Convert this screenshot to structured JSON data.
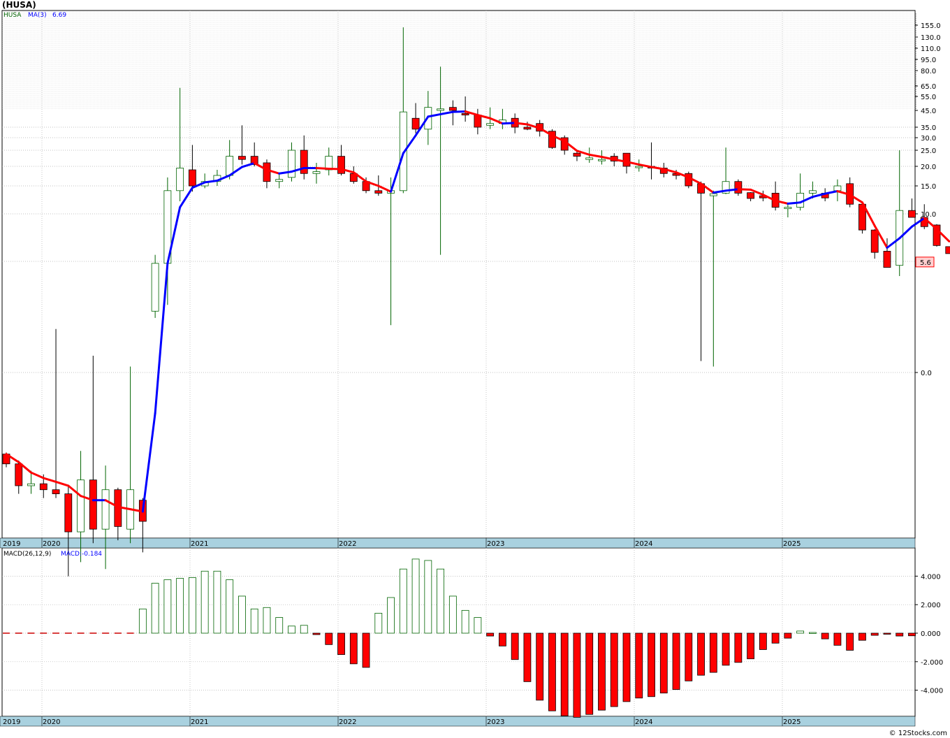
{
  "title": "(HUSA)",
  "watermark": "© 12Stocks.com",
  "colors": {
    "up": "#006400",
    "down": "#ff0000",
    "ma_up": "#0000ff",
    "ma_down": "#ff0000",
    "year_band": "#a9d1df",
    "grid": "#b0b0b0"
  },
  "chart_data": [
    {
      "type": "candlestick",
      "legend": {
        "ticker": "HUSA",
        "ma_label": "MA(3)",
        "ma_value": "6.69"
      },
      "y_scale": "log",
      "y_ticks": [
        "155.0",
        "130.0",
        "110.0",
        "95.0",
        "80.0",
        "65.0",
        "55.0",
        "45.0",
        "35.0",
        "30.0",
        "25.0",
        "20.0",
        "15.0",
        "10.0",
        "5.0",
        "0.0"
      ],
      "last_price_label": "5.6",
      "years": [
        "2019",
        "2020",
        "2021",
        "2022",
        "2023",
        "2024",
        "2025"
      ],
      "ohlc": [
        [
          0.9,
          0.91,
          0.82,
          0.84
        ],
        [
          0.84,
          0.86,
          0.68,
          0.72
        ],
        [
          0.72,
          0.8,
          0.68,
          0.73
        ],
        [
          0.73,
          0.78,
          0.66,
          0.7
        ],
        [
          0.7,
          2.5,
          0.66,
          0.68
        ],
        [
          0.68,
          0.72,
          0.38,
          0.52
        ],
        [
          0.52,
          0.92,
          0.42,
          0.75
        ],
        [
          0.75,
          1.9,
          0.48,
          0.53
        ],
        [
          0.53,
          0.83,
          0.4,
          0.7
        ],
        [
          0.7,
          0.71,
          0.49,
          0.54
        ],
        [
          0.53,
          1.7,
          0.48,
          0.7
        ],
        [
          0.65,
          0.66,
          0.45,
          0.56
        ],
        [
          3.0,
          5.5,
          2.8,
          4.9
        ],
        [
          4.9,
          17.0,
          3.2,
          14.0
        ],
        [
          14.0,
          63.0,
          12.0,
          19.5
        ],
        [
          19.0,
          27.0,
          13.8,
          15.0
        ],
        [
          15.0,
          18.0,
          14.5,
          16.0
        ],
        [
          16.0,
          19.0,
          15.0,
          17.5
        ],
        [
          17.5,
          29.0,
          16.5,
          23.0
        ],
        [
          23.0,
          36.0,
          20.5,
          22.0
        ],
        [
          23.0,
          28.0,
          20.0,
          20.5
        ],
        [
          21.0,
          22.0,
          14.5,
          16.0
        ],
        [
          16.0,
          18.0,
          14.5,
          16.5
        ],
        [
          17.0,
          28.0,
          16.0,
          25.0
        ],
        [
          25.0,
          31.0,
          16.5,
          18.0
        ],
        [
          18.0,
          21.0,
          15.5,
          18.5
        ],
        [
          19.0,
          26.0,
          17.5,
          23.0
        ],
        [
          23.0,
          27.0,
          17.5,
          18.0
        ],
        [
          18.0,
          20.0,
          15.5,
          16.0
        ],
        [
          16.0,
          17.0,
          13.5,
          14.0
        ],
        [
          14.0,
          17.5,
          13.0,
          13.5
        ],
        [
          13.5,
          17.0,
          2.6,
          14.0
        ],
        [
          14.0,
          150.0,
          13.5,
          44.0
        ],
        [
          40.0,
          50.0,
          32.0,
          34.0
        ],
        [
          34.0,
          60.0,
          27.0,
          47.0
        ],
        [
          45.0,
          85.0,
          5.5,
          46.0
        ],
        [
          47.0,
          52.0,
          36.0,
          45.0
        ],
        [
          43.0,
          55.0,
          38.0,
          42.0
        ],
        [
          42.0,
          46.0,
          31.5,
          35.0
        ],
        [
          36.0,
          47.0,
          34.0,
          37.0
        ],
        [
          37.0,
          46.0,
          34.0,
          39.0
        ],
        [
          40.0,
          43.0,
          32.0,
          35.0
        ],
        [
          35.0,
          38.0,
          33.5,
          34.0
        ],
        [
          37.0,
          39.0,
          30.5,
          33.0
        ],
        [
          33.0,
          34.0,
          25.5,
          26.0
        ],
        [
          30.0,
          31.0,
          23.5,
          25.0
        ],
        [
          24.0,
          25.0,
          21.5,
          23.0
        ],
        [
          22.0,
          26.0,
          21.0,
          22.5
        ],
        [
          22.0,
          25.0,
          20.5,
          22.0
        ],
        [
          23.0,
          24.0,
          20.0,
          21.5
        ],
        [
          24.0,
          24.0,
          18.0,
          20.0
        ],
        [
          20.0,
          22.0,
          18.5,
          20.0
        ],
        [
          20.0,
          28.0,
          16.5,
          19.5
        ],
        [
          19.5,
          21.0,
          17.0,
          18.0
        ],
        [
          18.0,
          19.0,
          16.5,
          17.5
        ],
        [
          18.0,
          18.5,
          14.5,
          15.0
        ],
        [
          15.5,
          16.0,
          1.8,
          13.5
        ],
        [
          13.0,
          14.0,
          1.7,
          13.4
        ],
        [
          13.5,
          26.0,
          13.3,
          16.0
        ],
        [
          16.0,
          16.5,
          13.0,
          13.5
        ],
        [
          13.6,
          13.7,
          12.0,
          12.5
        ],
        [
          13.0,
          14.0,
          12.0,
          12.6
        ],
        [
          13.5,
          16.0,
          10.5,
          11.0
        ],
        [
          11.0,
          11.5,
          9.5,
          11.0
        ],
        [
          11.0,
          18.0,
          10.5,
          13.5
        ],
        [
          13.5,
          16.0,
          12.5,
          14.0
        ],
        [
          13.5,
          14.5,
          12.0,
          12.6
        ],
        [
          14.0,
          16.5,
          12.0,
          15.0
        ],
        [
          15.5,
          17.0,
          11.0,
          11.5
        ],
        [
          11.5,
          12.0,
          7.5,
          7.9
        ],
        [
          7.9,
          8.0,
          5.2,
          5.7
        ],
        [
          5.8,
          7.0,
          4.7,
          4.7
        ],
        [
          4.8,
          25.0,
          4.3,
          10.5
        ],
        [
          10.5,
          12.5,
          9.5,
          9.5
        ],
        [
          9.5,
          11.5,
          8.0,
          8.3
        ],
        [
          8.5,
          8.6,
          6.2,
          6.3
        ],
        [
          6.2,
          6.2,
          5.6,
          5.6
        ]
      ],
      "ma": [
        0.9,
        0.85,
        0.79,
        0.76,
        0.74,
        0.72,
        0.67,
        0.65,
        0.65,
        0.62,
        0.61,
        0.6,
        1.2,
        4.9,
        11.0,
        14.6,
        15.8,
        16.2,
        17.5,
        19.8,
        20.9,
        19.0,
        18.0,
        18.5,
        19.5,
        19.5,
        19.3,
        19.2,
        18.3,
        16.0,
        15.0,
        13.8,
        24.0,
        31.0,
        41.0,
        42.5,
        44.0,
        44.3,
        42.0,
        40.0,
        37.0,
        37.3,
        36.5,
        34.5,
        31.0,
        28.5,
        24.8,
        23.5,
        22.8,
        22.0,
        21.3,
        20.5,
        19.8,
        19.2,
        18.3,
        17.0,
        15.5,
        13.6,
        14.0,
        14.3,
        14.2,
        13.2,
        12.1,
        11.6,
        11.8,
        12.8,
        13.4,
        13.9,
        13.2,
        11.8,
        8.4,
        6.1,
        7.0,
        8.3,
        9.4,
        8.0,
        6.7
      ]
    },
    {
      "type": "bar",
      "legend": {
        "name": "MACD(26,12,9)",
        "value_label": "MACD:-0.184"
      },
      "y_ticks": [
        "4.000",
        "2.000",
        "0.000",
        "-2.000",
        "-4.000"
      ],
      "ylim": [
        -5.8,
        5.3
      ],
      "values": [
        0,
        0,
        0,
        0,
        0,
        0,
        0,
        0,
        0,
        0,
        0,
        1.7,
        3.5,
        3.75,
        3.85,
        3.9,
        4.35,
        4.35,
        3.75,
        2.6,
        1.7,
        1.8,
        1.1,
        0.5,
        0.55,
        -0.1,
        -0.8,
        -1.5,
        -2.15,
        -2.4,
        1.4,
        2.5,
        4.5,
        5.2,
        5.1,
        4.5,
        2.6,
        1.6,
        1.1,
        -0.2,
        -0.9,
        -1.85,
        -3.4,
        -4.7,
        -5.45,
        -5.8,
        -5.9,
        -5.7,
        -5.4,
        -5.15,
        -4.8,
        -4.55,
        -4.45,
        -4.2,
        -3.95,
        -3.35,
        -2.95,
        -2.75,
        -2.25,
        -2.05,
        -1.8,
        -1.15,
        -0.7,
        -0.35,
        0.15,
        0.05,
        -0.4,
        -0.85,
        -1.2,
        -0.5,
        -0.15,
        -0.05,
        -0.2,
        -0.184
      ]
    }
  ]
}
